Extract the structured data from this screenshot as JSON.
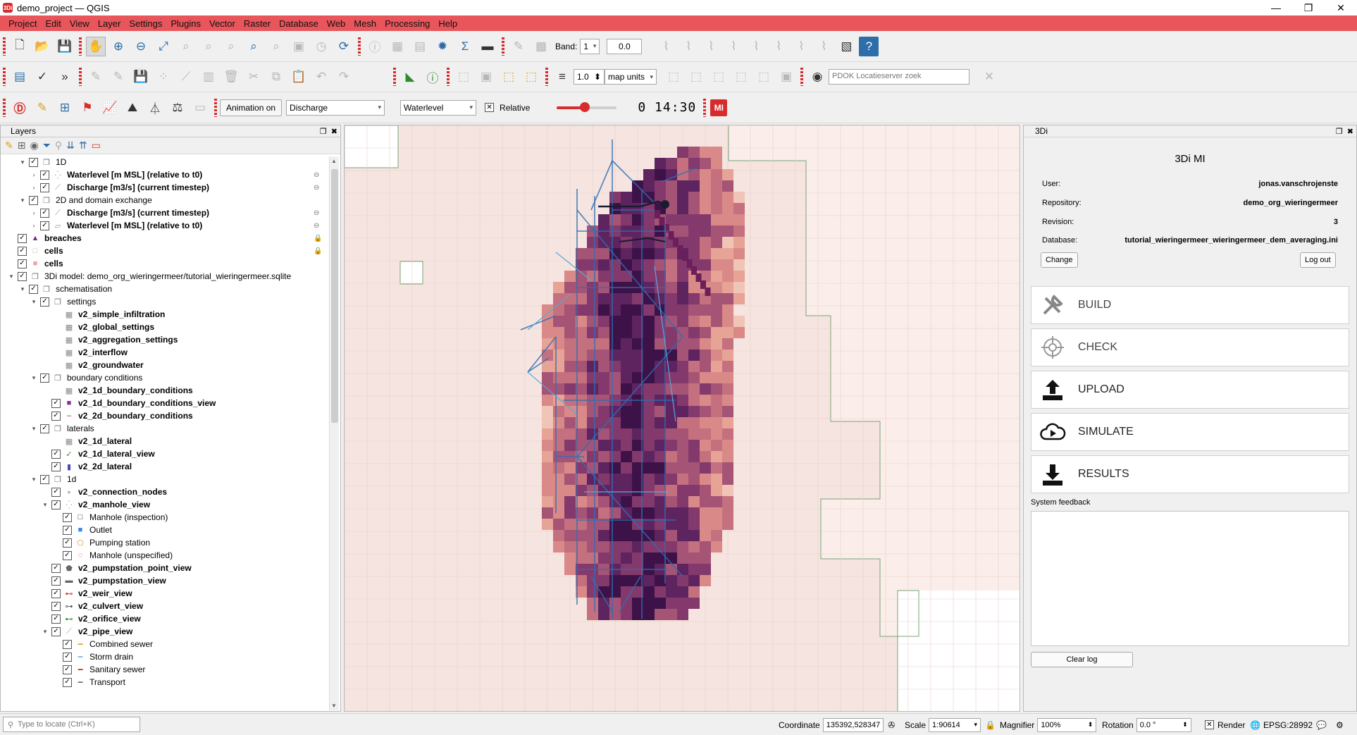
{
  "window": {
    "title": "demo_project — QGIS",
    "app_logo": "3Di",
    "minimize": "—",
    "maximize": "❐",
    "close": "✕"
  },
  "menu": [
    "Project",
    "Edit",
    "View",
    "Layer",
    "Settings",
    "Plugins",
    "Vector",
    "Raster",
    "Database",
    "Web",
    "Mesh",
    "Processing",
    "Help"
  ],
  "toolbar": {
    "band_label": "Band:",
    "band_value": "1",
    "band_spin_value": "0.0",
    "width_value": "1.0",
    "units_value": "map units",
    "locator_placeholder": "PDOK Locatieserver zoek"
  },
  "threedi_toolbar": {
    "animation_button": "Animation on",
    "line_variable": "Discharge",
    "node_variable": "Waterlevel",
    "relative_label": "Relative",
    "relative_checked": "✕",
    "time_value": "0 14:30",
    "slider_fraction": 0.46,
    "mi_icon_text": "MI"
  },
  "layers_panel": {
    "title": "Layers",
    "rows": [
      {
        "indent": 0,
        "exp": "▾",
        "check": "✓",
        "icon": "group-icon",
        "label": "1D",
        "bold": false
      },
      {
        "indent": 1,
        "exp": "›",
        "check": "✓",
        "icon": "points-icon",
        "label": "Waterlevel [m MSL] (relative to t0)",
        "bold": true,
        "side": "⊖"
      },
      {
        "indent": 1,
        "exp": "›",
        "check": "✓",
        "icon": "lines-icon",
        "label": "Discharge [m3/s] (current timestep)",
        "bold": true,
        "side": "⊖"
      },
      {
        "indent": 0,
        "exp": "▾",
        "check": "✓",
        "icon": "group-icon",
        "label": "2D and domain exchange",
        "bold": false
      },
      {
        "indent": 1,
        "exp": "›",
        "check": "✓",
        "icon": "lines-icon",
        "label": "Discharge [m3/s] (current timestep)",
        "bold": true,
        "side": "⊖"
      },
      {
        "indent": 1,
        "exp": "›",
        "check": "✓",
        "icon": "polygon-icon",
        "label": "Waterlevel [m MSL] (relative to t0)",
        "bold": true,
        "side": "⊖"
      },
      {
        "indent": -1,
        "exp": "",
        "check": "✓",
        "icon": "triangle-icon",
        "label": "breaches",
        "bold": true,
        "side": "🔒"
      },
      {
        "indent": -1,
        "exp": "",
        "check": "✓",
        "icon": "white-square-icon",
        "label": "cells",
        "bold": true,
        "side": "🔒"
      },
      {
        "indent": -1,
        "exp": "",
        "check": "✓",
        "icon": "pink-square-icon",
        "label": "cells",
        "bold": true
      },
      {
        "indent": -1,
        "exp": "▾",
        "check": "✓",
        "icon": "group-icon",
        "label": "3Di model: demo_org_wieringermeer/tutorial_wieringermeer.sqlite",
        "bold": false
      },
      {
        "indent": 0,
        "exp": "▾",
        "check": "✓",
        "icon": "group-icon",
        "label": "schematisation",
        "bold": false
      },
      {
        "indent": 1,
        "exp": "▾",
        "check": "✓",
        "icon": "group-icon",
        "label": "settings",
        "bold": false
      },
      {
        "indent": 2,
        "exp": "",
        "check": "",
        "icon": "table-icon",
        "label": "v2_simple_infiltration",
        "bold": true
      },
      {
        "indent": 2,
        "exp": "",
        "check": "",
        "icon": "table-icon",
        "label": "v2_global_settings",
        "bold": true
      },
      {
        "indent": 2,
        "exp": "",
        "check": "",
        "icon": "table-icon",
        "label": "v2_aggregation_settings",
        "bold": true
      },
      {
        "indent": 2,
        "exp": "",
        "check": "",
        "icon": "table-icon",
        "label": "v2_interflow",
        "bold": true
      },
      {
        "indent": 2,
        "exp": "",
        "check": "",
        "icon": "table-icon",
        "label": "v2_groundwater",
        "bold": true
      },
      {
        "indent": 1,
        "exp": "▾",
        "check": "✓",
        "icon": "group-icon",
        "label": "boundary conditions",
        "bold": false
      },
      {
        "indent": 2,
        "exp": "",
        "check": "",
        "icon": "table-icon",
        "label": "v2_1d_boundary_conditions",
        "bold": true
      },
      {
        "indent": 2,
        "exp": "",
        "check": "✓",
        "icon": "purple-square-icon",
        "label": "v2_1d_boundary_conditions_view",
        "bold": true
      },
      {
        "indent": 2,
        "exp": "",
        "check": "✓",
        "icon": "red-dash-icon",
        "label": "v2_2d_boundary_conditions",
        "bold": true
      },
      {
        "indent": 1,
        "exp": "▾",
        "check": "✓",
        "icon": "group-icon",
        "label": "laterals",
        "bold": false
      },
      {
        "indent": 2,
        "exp": "",
        "check": "",
        "icon": "table-icon",
        "label": "v2_1d_lateral",
        "bold": true
      },
      {
        "indent": 2,
        "exp": "",
        "check": "✓",
        "icon": "green-tick-icon",
        "label": "v2_1d_lateral_view",
        "bold": true
      },
      {
        "indent": 2,
        "exp": "",
        "check": "✓",
        "icon": "blue-marker-icon",
        "label": "v2_2d_lateral",
        "bold": true
      },
      {
        "indent": 1,
        "exp": "▾",
        "check": "✓",
        "icon": "group-icon",
        "label": "1d",
        "bold": false
      },
      {
        "indent": 2,
        "exp": "",
        "check": "✓",
        "icon": "node-icon",
        "label": "v2_connection_nodes",
        "bold": true
      },
      {
        "indent": 2,
        "exp": "▾",
        "check": "✓",
        "icon": "points-icon",
        "label": "v2_manhole_view",
        "bold": true
      },
      {
        "indent": 3,
        "exp": "",
        "check": "✓",
        "icon": "square-outline-icon",
        "label": "Manhole (inspection)",
        "bold": false
      },
      {
        "indent": 3,
        "exp": "",
        "check": "✓",
        "icon": "blue-square-icon",
        "label": "Outlet",
        "bold": false
      },
      {
        "indent": 3,
        "exp": "",
        "check": "✓",
        "icon": "pentagon-icon",
        "label": "Pumping station",
        "bold": false
      },
      {
        "indent": 3,
        "exp": "",
        "check": "✓",
        "icon": "dotted-circle-icon",
        "label": "Manhole (unspecified)",
        "bold": false
      },
      {
        "indent": 2,
        "exp": "",
        "check": "✓",
        "icon": "grey-pentagon-icon",
        "label": "v2_pumpstation_point_view",
        "bold": true
      },
      {
        "indent": 2,
        "exp": "",
        "check": "✓",
        "icon": "pump-line-icon",
        "label": "v2_pumpstation_view",
        "bold": true
      },
      {
        "indent": 2,
        "exp": "",
        "check": "✓",
        "icon": "weir-icon",
        "label": "v2_weir_view",
        "bold": true
      },
      {
        "indent": 2,
        "exp": "",
        "check": "✓",
        "icon": "culvert-icon",
        "label": "v2_culvert_view",
        "bold": true
      },
      {
        "indent": 2,
        "exp": "",
        "check": "✓",
        "icon": "orifice-icon",
        "label": "v2_orifice_view",
        "bold": true
      },
      {
        "indent": 2,
        "exp": "▾",
        "check": "✓",
        "icon": "lines-icon",
        "label": "v2_pipe_view",
        "bold": true
      },
      {
        "indent": 3,
        "exp": "",
        "check": "✓",
        "icon": "orange-line-icon",
        "label": "Combined sewer",
        "bold": false
      },
      {
        "indent": 3,
        "exp": "",
        "check": "✓",
        "icon": "lightblue-line-icon",
        "label": "Storm drain",
        "bold": false
      },
      {
        "indent": 3,
        "exp": "",
        "check": "✓",
        "icon": "red-line-icon",
        "label": "Sanitary sewer",
        "bold": false
      },
      {
        "indent": 3,
        "exp": "",
        "check": "✓",
        "icon": "grey-line-icon",
        "label": "Transport",
        "bold": false
      }
    ]
  },
  "threedi_panel": {
    "dock_title": "3Di",
    "title": "3Di MI",
    "user_label": "User:",
    "user_value": "jonas.vanschrojenste",
    "repo_label": "Repository:",
    "repo_value": "demo_org_wieringermeer",
    "rev_label": "Revision:",
    "rev_value": "3",
    "db_label": "Database:",
    "db_value": "tutorial_wieringermeer_wieringermeer_dem_averaging.ini",
    "change_button": "Change",
    "logout_button": "Log out",
    "actions": [
      "BUILD",
      "CHECK",
      "UPLOAD",
      "SIMULATE",
      "RESULTS"
    ],
    "feedback_label": "System feedback",
    "clear_button": "Clear log"
  },
  "statusbar": {
    "locate_placeholder": "Type to locate (Ctrl+K)",
    "coordinate_label": "Coordinate",
    "coordinate_value": "135392,528347",
    "scale_label": "Scale",
    "scale_value": "1:90614",
    "magnifier_label": "Magnifier",
    "magnifier_value": "100%",
    "rotation_label": "Rotation",
    "rotation_value": "0.0 °",
    "render_label": "Render",
    "crs_value": "EPSG:28992"
  },
  "colors": {
    "menubar": "#e8555a",
    "accent": "#d62c2c",
    "raster_dark": "#3d1248",
    "raster_light": "#f4ddd6",
    "network": "#2e6fb5"
  }
}
